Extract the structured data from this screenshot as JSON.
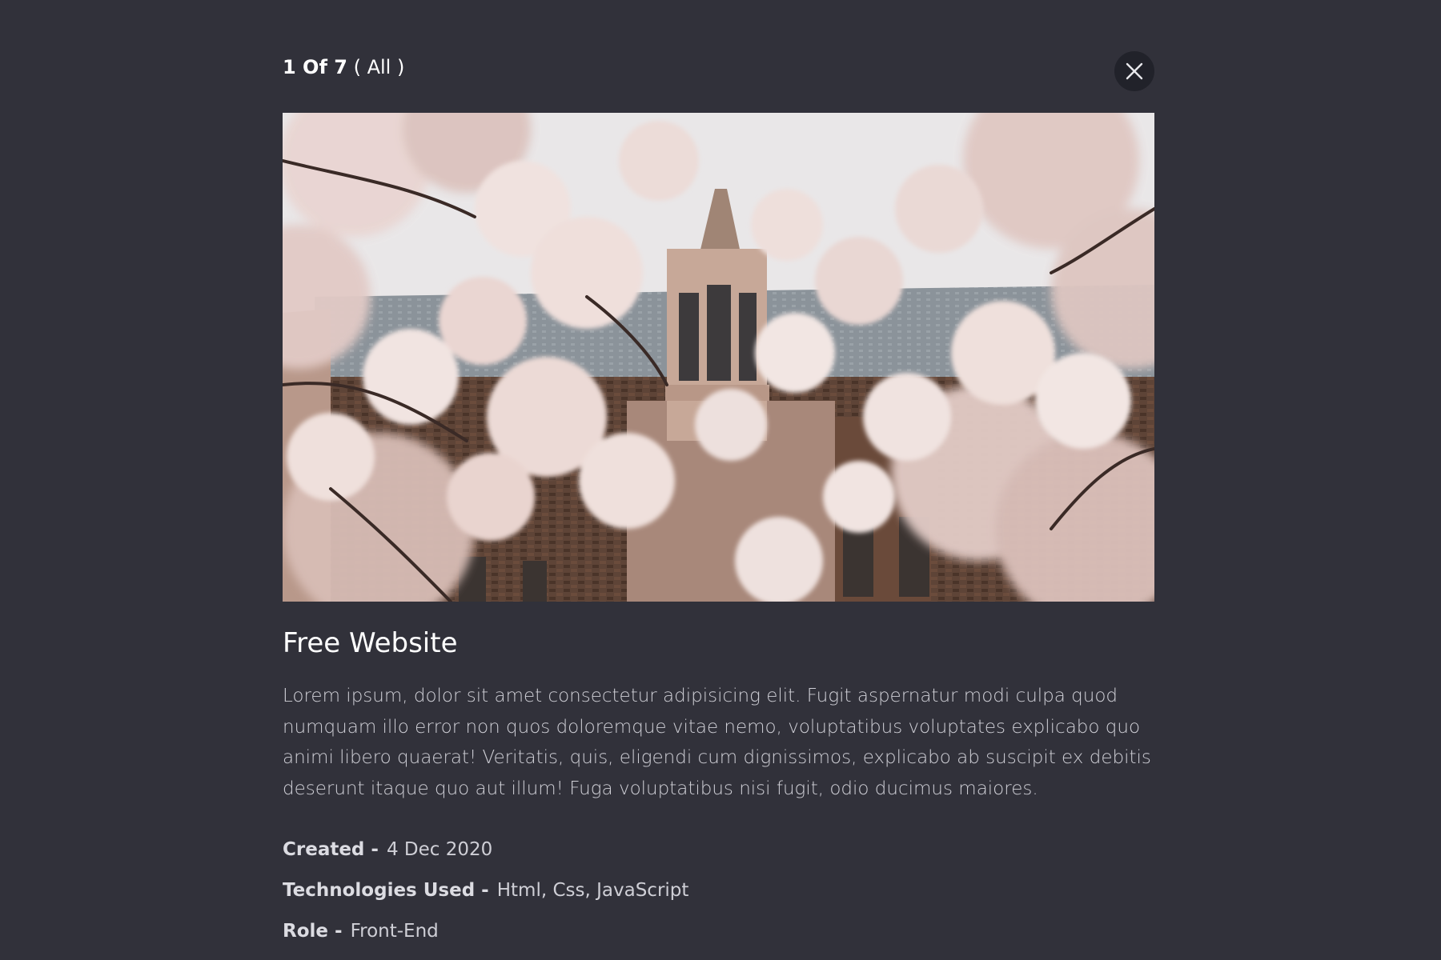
{
  "lightbox": {
    "counter_current": "1 Of 7",
    "counter_filter": "( All )",
    "close_icon": "close-icon"
  },
  "project": {
    "image_alt": "cherry blossoms in front of a brick building with a bell tower",
    "title": "Free Website",
    "description": "Lorem ipsum, dolor sit amet consectetur adipisicing elit. Fugit aspernatur modi culpa quod numquam illo error non quos doloremque vitae nemo, voluptatibus voluptates explicabo quo animi libero quaerat! Veritatis, quis, eligendi cum dignissimos, explicabo ab suscipit ex debitis deserunt itaque quo aut illum! Fuga voluptatibus nisi fugit, odio ducimus maiores.",
    "meta": {
      "created_label": "Created -",
      "created_value": "4 Dec 2020",
      "tech_label": "Technologies Used -",
      "tech_value": "Html, Css, JavaScript",
      "role_label": "Role -",
      "role_value": "Front-End"
    }
  },
  "colors": {
    "background": "#31313a",
    "close_button_bg": "#21222a",
    "text_primary": "#ffffff",
    "text_muted": "#cfcfd6"
  }
}
